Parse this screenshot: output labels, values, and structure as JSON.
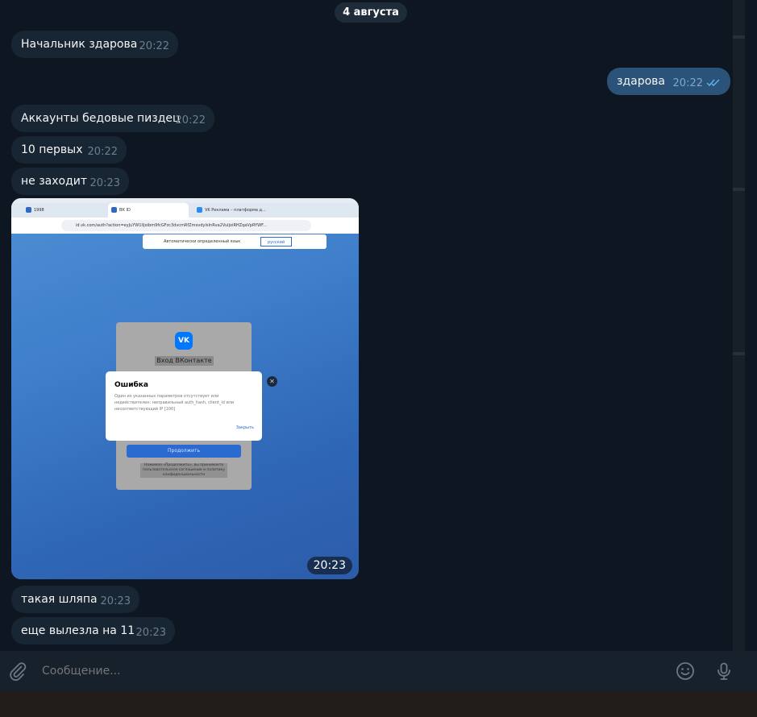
{
  "date_divider": "4 августа",
  "messages": [
    {
      "text": "Начальник здарова",
      "time": "20:22",
      "direction": "in"
    },
    {
      "text": "здарова",
      "time": "20:22",
      "direction": "out",
      "status": "read"
    },
    {
      "text": "Аккаунты бедовые пиздец",
      "time": "20:22",
      "direction": "in"
    },
    {
      "text": "10 первых",
      "time": "20:22",
      "direction": "in"
    },
    {
      "text": "не заходит",
      "time": "20:23",
      "direction": "in"
    },
    {
      "text": "такая шляпа",
      "time": "20:23",
      "direction": "in"
    },
    {
      "text": "еще вылезла на 11",
      "time": "20:23",
      "direction": "in"
    }
  ],
  "photo": {
    "time": "20:23",
    "screenshot": {
      "tabs": [
        "1998",
        "ВК ID",
        "VK Реклама – платформа д..."
      ],
      "url": "id.vk.com/auth?action=eyJuYW1lIjoibm9fcGFzc3dvcmRfZmxvdyIsInRva2VuIjoiRHZqaVpRYWF...",
      "translate_bar": {
        "text": "Автоматически определенный язык",
        "language": "русский"
      },
      "login_title": "Вход ВКонтакте",
      "vk_logo": "VK",
      "continue_label": "Продолжить",
      "legal_text": "Нажимая «Продолжить», вы принимаете пользовательское соглашение и политику конфиденциальности",
      "error_dialog": {
        "title": "Ошибка",
        "body": "Один из указанных параметров отсутствует или недействителен: неправильный auth_hash, client_id или несоответствующий IP [100]",
        "close_label": "Закрыть"
      }
    }
  },
  "composer": {
    "placeholder": "Сообщение...",
    "attach_icon": "paperclip-icon",
    "emoji_icon": "smile-icon",
    "mic_icon": "microphone-icon"
  },
  "colors": {
    "background": "#0e1621",
    "bubble_in": "#182533",
    "bubble_out": "#2b5278",
    "time_in": "#6d7f8f",
    "time_out": "#7da8d3",
    "read_checks": "#5eb5f7",
    "composer": "#17212b"
  }
}
